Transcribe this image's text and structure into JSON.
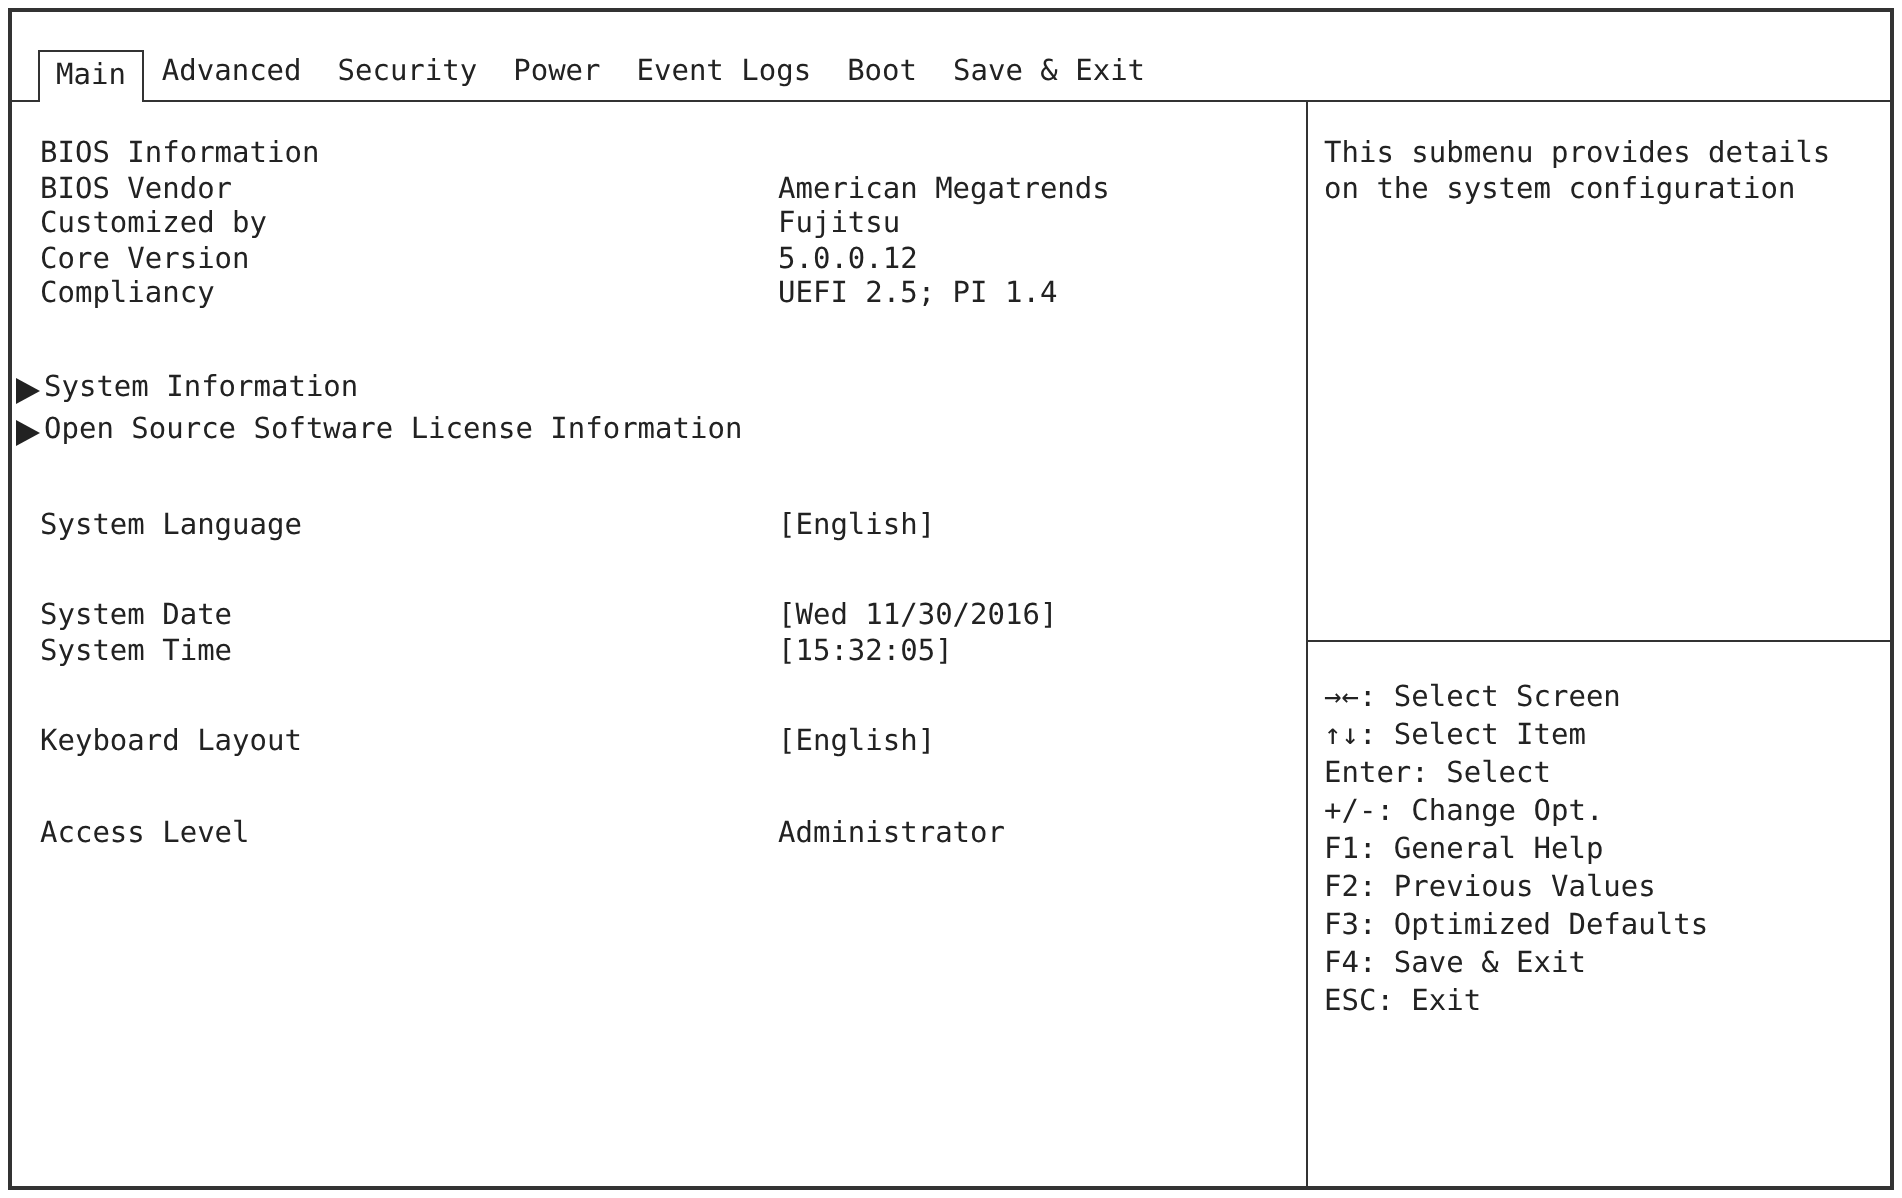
{
  "tabs": [
    {
      "label": "Main",
      "selected": true
    },
    {
      "label": "Advanced",
      "selected": false
    },
    {
      "label": "Security",
      "selected": false
    },
    {
      "label": "Power",
      "selected": false
    },
    {
      "label": "Event Logs",
      "selected": false
    },
    {
      "label": "Boot",
      "selected": false
    },
    {
      "label": "Save & Exit",
      "selected": false
    }
  ],
  "groups": [
    [
      {
        "kind": "heading",
        "label": "BIOS Information"
      },
      {
        "kind": "info",
        "label": "BIOS Vendor",
        "value": "American Megatrends"
      },
      {
        "kind": "info",
        "label": "Customized by",
        "value": "Fujitsu"
      },
      {
        "kind": "info",
        "label": "Core Version",
        "value": "5.0.0.12"
      },
      {
        "kind": "info",
        "label": "Compliancy",
        "value": "UEFI 2.5; PI 1.4"
      }
    ],
    [
      {
        "kind": "submenu",
        "label": "System Information"
      },
      {
        "kind": "submenu",
        "label": "Open Source Software License Information"
      }
    ],
    [
      {
        "kind": "setting",
        "label": "System Language",
        "value": "[English]"
      }
    ],
    [
      {
        "kind": "setting",
        "label": "System Date",
        "value": "[Wed 11/30/2016]"
      },
      {
        "kind": "setting",
        "label": "System Time",
        "value": "[15:32:05]"
      }
    ],
    [
      {
        "kind": "setting",
        "label": "Keyboard Layout",
        "value": "[English]"
      }
    ],
    [
      {
        "kind": "info",
        "label": "Access Level",
        "value": "Administrator"
      }
    ]
  ],
  "help": "This submenu provides details on the system configuration",
  "keys": [
    "→←: Select Screen",
    "↑↓: Select Item",
    "Enter: Select",
    "+/-: Change Opt.",
    "F1: General Help",
    "F2: Previous Values",
    "F3: Optimized Defaults",
    "F4: Save & Exit",
    "ESC: Exit"
  ]
}
